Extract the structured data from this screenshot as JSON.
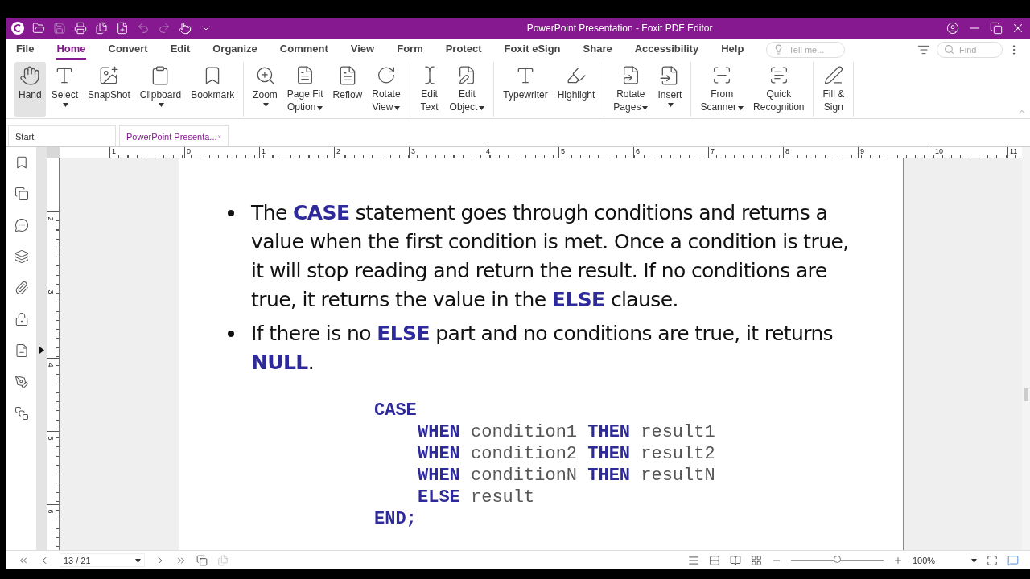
{
  "window": {
    "title": "PowerPoint Presentation - Foxit PDF Editor"
  },
  "menu_tabs": [
    {
      "label": "File",
      "selected": false
    },
    {
      "label": "Home",
      "selected": true
    },
    {
      "label": "Convert",
      "selected": false
    },
    {
      "label": "Edit",
      "selected": false
    },
    {
      "label": "Organize",
      "selected": false
    },
    {
      "label": "Comment",
      "selected": false
    },
    {
      "label": "View",
      "selected": false
    },
    {
      "label": "Form",
      "selected": false
    },
    {
      "label": "Protect",
      "selected": false
    },
    {
      "label": "Foxit eSign",
      "selected": false
    },
    {
      "label": "Share",
      "selected": false
    },
    {
      "label": "Accessibility",
      "selected": false
    },
    {
      "label": "Help",
      "selected": false
    }
  ],
  "tell_me": {
    "placeholder": "Tell me..."
  },
  "find": {
    "placeholder": "Find"
  },
  "ribbon": {
    "groups": [
      [
        {
          "lines": [
            "Hand"
          ],
          "dropdown": false,
          "selected": true
        },
        {
          "lines": [
            "Select"
          ],
          "dropdown": true,
          "selected": false
        },
        {
          "lines": [
            "SnapShot"
          ],
          "dropdown": false,
          "selected": false
        },
        {
          "lines": [
            "Clipboard"
          ],
          "dropdown": true,
          "selected": false
        },
        {
          "lines": [
            "Bookmark"
          ],
          "dropdown": false,
          "selected": false
        }
      ],
      [
        {
          "lines": [
            "Zoom"
          ],
          "dropdown": true,
          "selected": false
        },
        {
          "lines": [
            "Page Fit",
            "Option"
          ],
          "dropdown": true,
          "selected": false
        },
        {
          "lines": [
            "Reflow"
          ],
          "dropdown": false,
          "selected": false
        },
        {
          "lines": [
            "Rotate",
            "View"
          ],
          "dropdown": true,
          "selected": false
        }
      ],
      [
        {
          "lines": [
            "Edit",
            "Text"
          ],
          "dropdown": false,
          "selected": false
        },
        {
          "lines": [
            "Edit",
            "Object"
          ],
          "dropdown": true,
          "selected": false
        }
      ],
      [
        {
          "lines": [
            "Typewriter"
          ],
          "dropdown": false,
          "selected": false
        },
        {
          "lines": [
            "Highlight"
          ],
          "dropdown": false,
          "selected": false
        }
      ],
      [
        {
          "lines": [
            "Rotate",
            "Pages"
          ],
          "dropdown": true,
          "selected": false
        },
        {
          "lines": [
            "Insert"
          ],
          "dropdown": true,
          "selected": false
        }
      ],
      [
        {
          "lines": [
            "From",
            "Scanner"
          ],
          "dropdown": true,
          "selected": false
        },
        {
          "lines": [
            "Quick",
            "Recognition"
          ],
          "dropdown": false,
          "selected": false
        }
      ],
      [
        {
          "lines": [
            "Fill &",
            "Sign"
          ],
          "dropdown": false,
          "selected": false
        }
      ]
    ]
  },
  "doc_tabs": [
    {
      "label": "Start",
      "selected": false,
      "closable": false
    },
    {
      "label": "PowerPoint Presenta...",
      "selected": true,
      "closable": true
    }
  ],
  "rulers": {
    "horizontal": [
      "1",
      "0",
      "1",
      "2",
      "3",
      "4",
      "5",
      "6",
      "7",
      "8",
      "9",
      "10",
      "11"
    ],
    "vertical": [
      "2",
      "3",
      "4",
      "5",
      "6"
    ]
  },
  "page": {
    "bullets": [
      "The **CASE** statement goes through conditions and returns a value when the first condition is met. Once a condition is true, it will stop reading and return the result. If no conditions are true, it returns the value in the **ELSE** clause.",
      "If there is no **ELSE** part and no conditions are true, it returns **NULL**."
    ],
    "code": [
      {
        "indented": false,
        "parts": [
          {
            "kind": "keyword",
            "text": "CASE"
          }
        ]
      },
      {
        "indented": true,
        "parts": [
          {
            "kind": "keyword",
            "text": "WHEN"
          },
          {
            "kind": "plain",
            "text": " condition1 "
          },
          {
            "kind": "keyword",
            "text": "THEN"
          },
          {
            "kind": "plain",
            "text": " result1"
          }
        ]
      },
      {
        "indented": true,
        "parts": [
          {
            "kind": "keyword",
            "text": "WHEN"
          },
          {
            "kind": "plain",
            "text": " condition2 "
          },
          {
            "kind": "keyword",
            "text": "THEN"
          },
          {
            "kind": "plain",
            "text": " result2"
          }
        ]
      },
      {
        "indented": true,
        "parts": [
          {
            "kind": "keyword",
            "text": "WHEN"
          },
          {
            "kind": "plain",
            "text": " conditionN "
          },
          {
            "kind": "keyword",
            "text": "THEN"
          },
          {
            "kind": "plain",
            "text": " resultN"
          }
        ]
      },
      {
        "indented": true,
        "parts": [
          {
            "kind": "keyword",
            "text": "ELSE"
          },
          {
            "kind": "plain",
            "text": " result"
          }
        ]
      },
      {
        "indented": false,
        "parts": [
          {
            "kind": "keyword",
            "text": "END;"
          }
        ]
      }
    ]
  },
  "status_bar": {
    "page": "13 / 21",
    "zoom": "100%",
    "zoom_slider": {
      "level": 0.5
    }
  }
}
